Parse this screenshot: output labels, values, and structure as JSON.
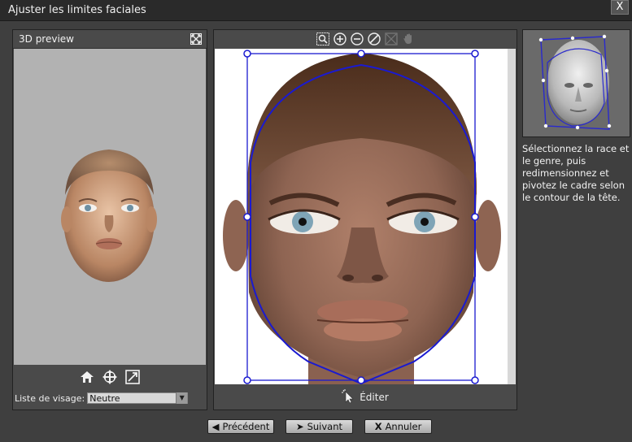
{
  "window": {
    "title": "Ajuster les limites faciales",
    "close_label": "X"
  },
  "preview_panel": {
    "title": "3D preview",
    "tools": [
      "home-icon",
      "rotate-icon",
      "fit-icon"
    ],
    "face_list_label": "Liste de visage:",
    "face_list_value": "Neutre"
  },
  "image_panel": {
    "toolbar_icons": [
      "zoom-region-icon",
      "zoom-in-icon",
      "zoom-out-icon",
      "reset-icon",
      "fit-disabled-icon",
      "pan-disabled-icon"
    ],
    "edit_label": "Éditer"
  },
  "help": {
    "text": "Sélectionnez la race et le genre, puis redimensionnez et pivotez le cadre selon le contour de la tête."
  },
  "buttons": {
    "previous": "Précédent",
    "next": "Suivant",
    "cancel": "Annuler"
  },
  "colors": {
    "frame_blue": "#1a1ad0",
    "preview_bg": "#b2b2b2",
    "panel_bg": "#4a4a4a"
  }
}
